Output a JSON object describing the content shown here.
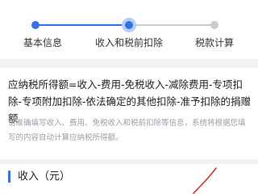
{
  "steps": [
    {
      "label": "基本信息",
      "state": "completed"
    },
    {
      "label": "收入和税前扣除",
      "state": "current"
    },
    {
      "label": "税款计算",
      "state": "pending"
    }
  ],
  "formula": {
    "text": "应纳税所得额=收入-费用-免税收入-减除费用-专项扣除-专项附加扣除-依法确定的其他扣除-准予扣除的捐赠额",
    "hint": "请准确填写收入、费用、免税收入和税前扣除等信息，系统将根据您填写的内容自动计算应纳税所得额。"
  },
  "income": {
    "title": "收入（元）"
  },
  "colors": {
    "accent": "#2f73e8",
    "inactive": "#c9ccd1",
    "mark": "#d9352b"
  }
}
